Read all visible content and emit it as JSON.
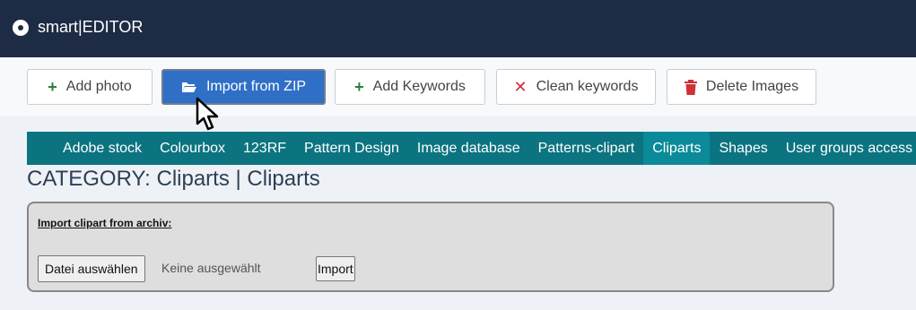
{
  "app": {
    "title": "smart|EDITOR",
    "logo_icon": "record-icon"
  },
  "toolbar": {
    "add_photo": {
      "label": "Add photo",
      "icon": "plus-icon"
    },
    "import_zip": {
      "label": "Import from ZIP",
      "icon": "folder-open-icon"
    },
    "add_keywords": {
      "label": "Add Keywords",
      "icon": "plus-icon"
    },
    "clean_keywords": {
      "label": "Clean keywords",
      "icon": "x-icon"
    },
    "delete_images": {
      "label": "Delete Images",
      "icon": "trash-icon"
    }
  },
  "categories": {
    "tabs": [
      "Adobe stock",
      "Colourbox",
      "123RF",
      "Pattern Design",
      "Image database",
      "Patterns-clipart",
      "Cliparts",
      "Shapes",
      "User groups access"
    ],
    "active_tab": "Cliparts"
  },
  "category_heading": "CATEGORY: Cliparts | Cliparts",
  "import_panel": {
    "label": "Import clipart from archiv:",
    "file_button": "Datei auswählen",
    "file_status": "Keine ausgewählt",
    "import_button": "Import"
  },
  "colors": {
    "topbar": "#1e2b44",
    "primary": "#2f6fc6",
    "nav": "#0b7480",
    "nav_active": "#0b8a99",
    "add_green": "#2e7d3b",
    "delete_red": "#d0303a"
  }
}
